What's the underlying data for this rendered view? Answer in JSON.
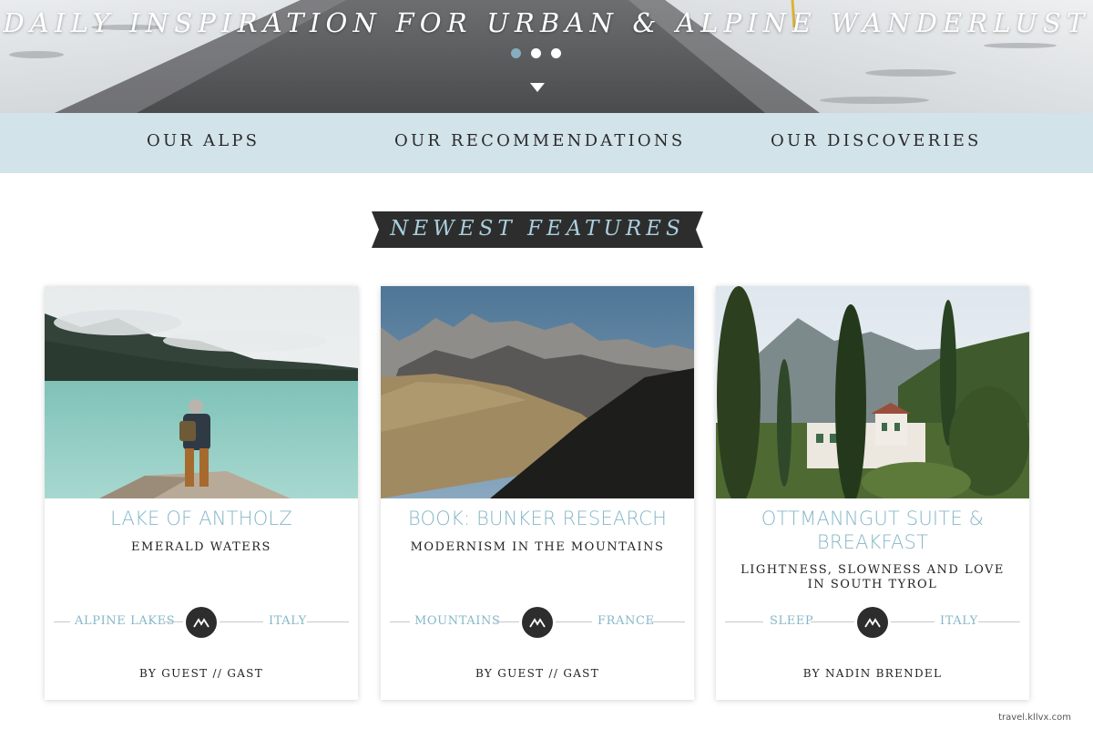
{
  "hero": {
    "tagline": "DAILY INSPIRATION FOR URBAN & ALPINE WANDERLUST",
    "slides": [
      {
        "active": true
      },
      {
        "active": false
      },
      {
        "active": false
      }
    ],
    "scroll_icon": "chevron-down-icon"
  },
  "nav": {
    "items": [
      {
        "label": "OUR ALPS"
      },
      {
        "label": "OUR RECOMMENDATIONS"
      },
      {
        "label": "OUR DISCOVERIES"
      }
    ]
  },
  "section": {
    "title": "NEWEST FEATURES"
  },
  "cards": [
    {
      "title": "LAKE OF ANTHOLZ",
      "subtitle": "EMERALD WATERS",
      "category": "ALPINE LAKES",
      "country": "ITALY",
      "author": "BY GUEST // GAST",
      "icon": "mountain-logo-icon"
    },
    {
      "title": "BOOK: BUNKER RESEARCH",
      "subtitle": "MODERNISM IN THE MOUNTAINS",
      "category": "MOUNTAINS",
      "country": "FRANCE",
      "author": "BY GUEST // GAST",
      "icon": "mountain-logo-icon"
    },
    {
      "title": "OTTMANNGUT SUITE & BREAKFAST",
      "subtitle": "LIGHTNESS, SLOWNESS AND LOVE IN SOUTH TYROL",
      "category": "SLEEP",
      "country": "ITALY",
      "author": "BY NADIN BRENDEL",
      "icon": "mountain-logo-icon"
    }
  ],
  "watermark": "travel.kllvx.com",
  "colors": {
    "accent": "#86b7c9",
    "nav_bg": "#d2e3ea",
    "banner_bg": "#2d2d2d",
    "text": "#222222"
  }
}
